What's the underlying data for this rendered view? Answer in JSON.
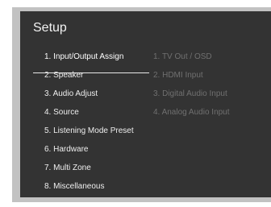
{
  "header": {
    "title": "Setup"
  },
  "menu": {
    "items": [
      {
        "label": "1. Input/Output Assign"
      },
      {
        "label": "2. Speaker"
      },
      {
        "label": "3. Audio Adjust"
      },
      {
        "label": "4. Source"
      },
      {
        "label": "5. Listening Mode Preset"
      },
      {
        "label": "6. Hardware"
      },
      {
        "label": "7. Multi Zone"
      },
      {
        "label": "8. Miscellaneous"
      }
    ],
    "selected_index": 0
  },
  "submenu": {
    "items": [
      {
        "label": "1. TV Out / OSD"
      },
      {
        "label": "2. HDMI Input"
      },
      {
        "label": "3. Digital Audio Input"
      },
      {
        "label": "4. Analog Audio Input"
      }
    ]
  },
  "colors": {
    "screen_background": "#333333",
    "frame_border": "#c2c2c2",
    "menu_text": "#eeeeee",
    "submenu_text_dim": "#707070"
  }
}
